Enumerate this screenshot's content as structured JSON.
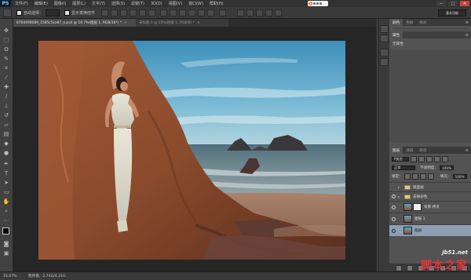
{
  "app": {
    "logo": "PS",
    "menu": [
      "文件(F)",
      "编辑(E)",
      "图像(I)",
      "图层(L)",
      "文字(Y)",
      "选择(S)",
      "滤镜(T)",
      "3D(D)",
      "视图(V)",
      "窗口(W)",
      "帮助(H)"
    ],
    "window_controls": [
      "—",
      "□",
      "✕"
    ]
  },
  "options": {
    "auto_select_label": "自动选择：",
    "show_transform_label": "显示变换控件",
    "workspace": "基本功能"
  },
  "tabs": [
    {
      "label": "8764494089_1585c5ca87_o.psd @ 16.7%(图层 1, RGB/16*) *",
      "close": "×"
    },
    {
      "label": "未标题-1 @ 25%(图层 1, RGB/8) *",
      "close": "×"
    }
  ],
  "status": {
    "zoom": "16.67%",
    "doc": "暂存盘：2.74G/4.21G"
  },
  "right_panel": {
    "tabs_top": [
      "颜色",
      "色板",
      "样式"
    ],
    "props_tab": "属性",
    "props_label": "无属性",
    "layers_tabs": [
      "图层",
      "通道",
      "路径"
    ],
    "filter_label": "P类型",
    "blend_mode": "正常",
    "opacity_label": "不透明度：",
    "opacity_value": "100%",
    "lock_label": "锁定：",
    "fill_label": "填充：",
    "fill_value": "100%",
    "layers": [
      {
        "name": "锐度层",
        "type": "folder",
        "visible": false
      },
      {
        "name": "去除杂色",
        "type": "folder",
        "visible": true
      },
      {
        "name": "背景 拷贝",
        "type": "mask",
        "visible": true
      },
      {
        "name": "图层 1",
        "type": "image",
        "visible": true
      },
      {
        "name": "图层",
        "type": "image",
        "visible": true,
        "selected": true
      }
    ]
  },
  "watermark": {
    "url": "jb51.net",
    "brand": "脚本之家"
  },
  "colors": {
    "chrome_dark": "#323232",
    "panel": "#535353",
    "selected_layer": "#8f9fb3",
    "brand_red": "#e23535"
  }
}
